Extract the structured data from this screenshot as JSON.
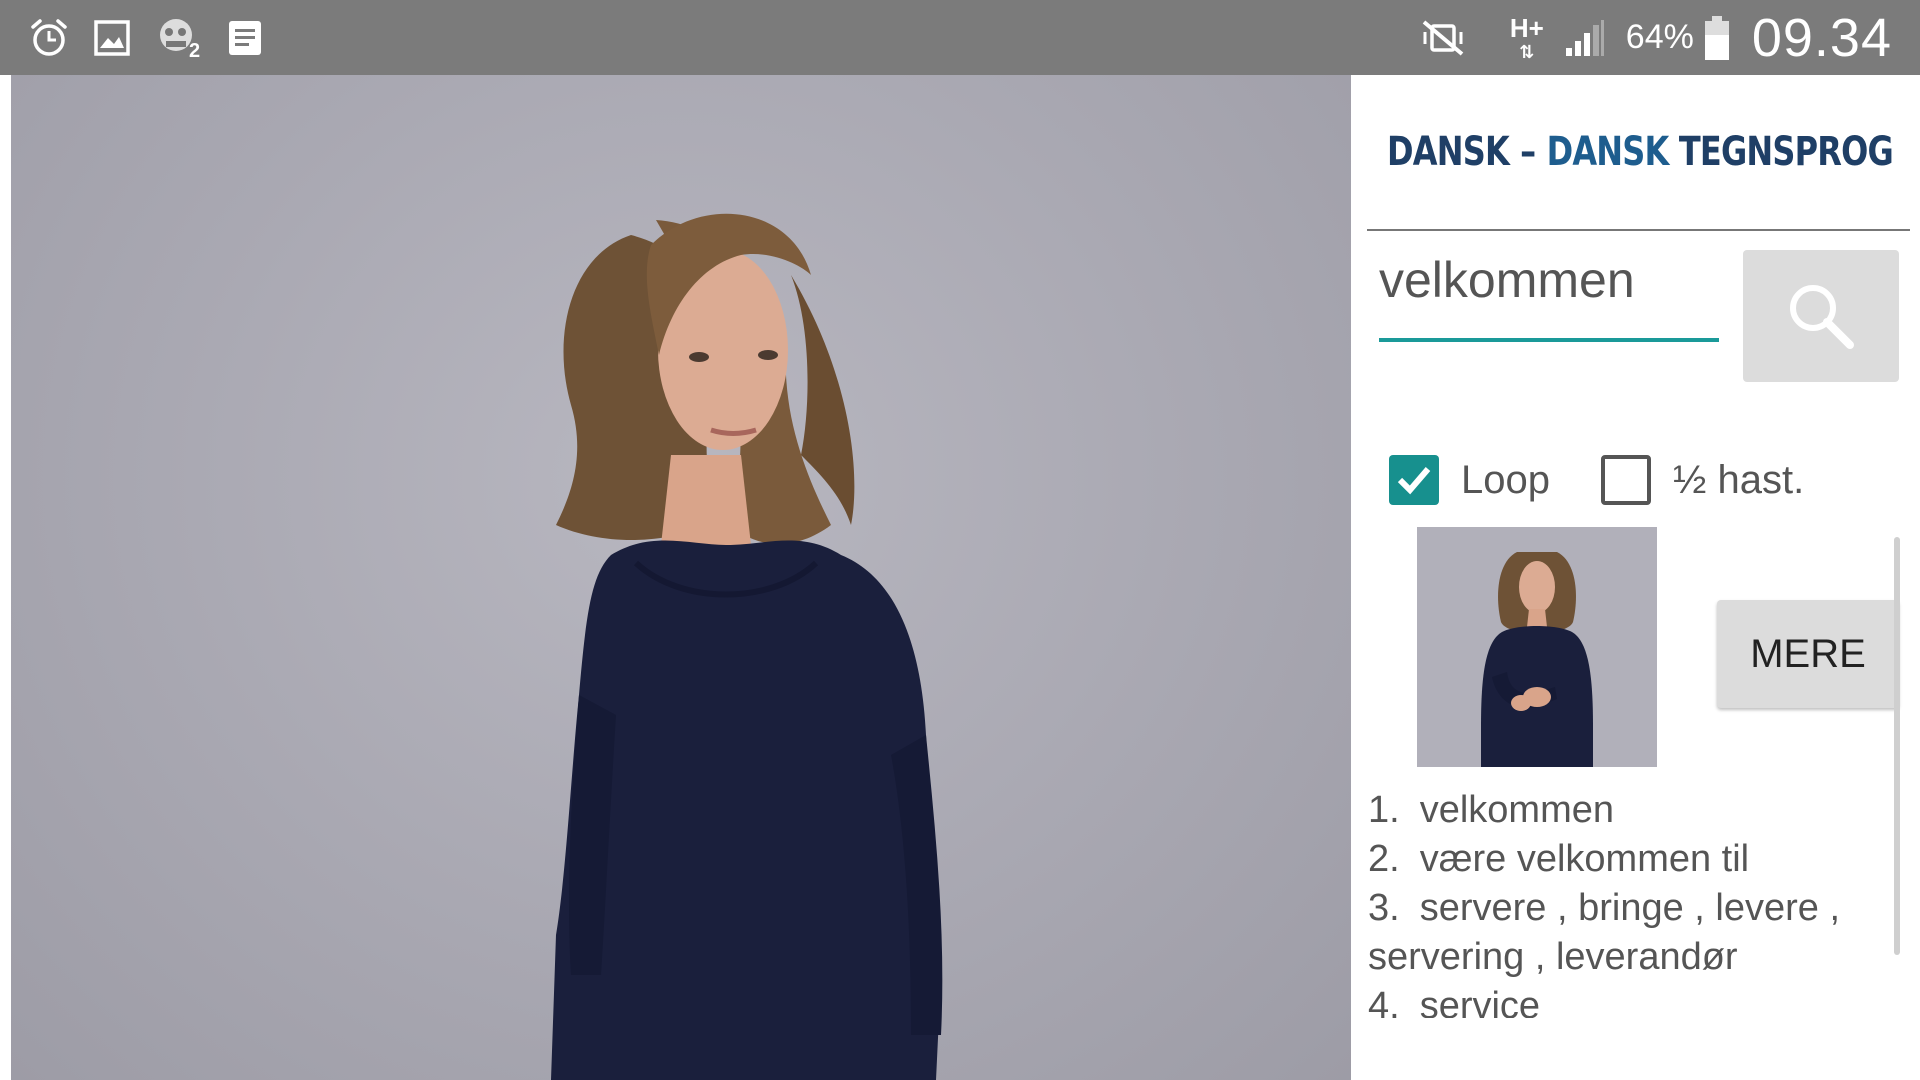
{
  "status_bar": {
    "left_icons": [
      "alarm-clock-icon",
      "gallery-icon",
      "game-notification-icon",
      "note-icon"
    ],
    "right_icons": [
      "vibrate-mute-icon",
      "network-type-icon",
      "signal-strength-icon",
      "battery-icon"
    ],
    "network_type": "H+",
    "battery_percent": "64%",
    "battery_level": 0.64,
    "time": "09.34"
  },
  "video": {
    "description_icon": "sign-language-video"
  },
  "header": {
    "logo_icon": "spine-logo-icon",
    "title_part1": "DANSK",
    "title_dash": "–",
    "title_part2": "DANSK",
    "title_part3": "TEGNSPROG"
  },
  "search": {
    "value": "velkommen",
    "button_icon": "magnifier-icon"
  },
  "options": {
    "loop": {
      "label": "Loop",
      "checked": true
    },
    "half_speed": {
      "label": "½ hast.",
      "checked": false
    }
  },
  "more_button": "MERE",
  "results": [
    {
      "num": "1.",
      "text": "velkommen"
    },
    {
      "num": "2.",
      "text": "være velkommen til"
    },
    {
      "num": "3.",
      "text": "servere , bringe , levere , servering , leverandør"
    },
    {
      "num": "4.",
      "text": "service"
    }
  ],
  "colors": {
    "status_bar": "#7b7b7b",
    "accent_teal": "#17908e",
    "logo_dark": "#1f3f66",
    "logo_blue": "#1e5d8e",
    "button_gray": "#dcdcdc"
  }
}
